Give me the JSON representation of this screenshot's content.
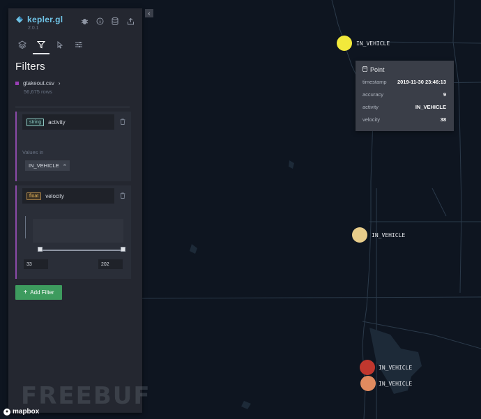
{
  "app": {
    "name": "kepler.gl",
    "version": "2.0.1"
  },
  "panel": {
    "title": "Filters",
    "dataset": {
      "name": "gtakeout.csv",
      "rows": "56,675 rows",
      "color": "#9a3fb5"
    },
    "filters": [
      {
        "type": "string",
        "field": "activity",
        "values_label": "Values in",
        "selected_value": "IN_VEHICLE"
      },
      {
        "type": "float",
        "field": "velocity",
        "range_min": "33",
        "range_max": "202"
      }
    ],
    "add_filter_label": "Add Filter"
  },
  "tooltip": {
    "title": "Point",
    "rows": [
      {
        "key": "timestamp",
        "value": "2019-11-30 23:46:13"
      },
      {
        "key": "accuracy",
        "value": "9"
      },
      {
        "key": "activity",
        "value": "IN_VEHICLE"
      },
      {
        "key": "velocity",
        "value": "38"
      }
    ]
  },
  "map_points": [
    {
      "label": "IN_VEHICLE",
      "color": "#f2e93b"
    },
    {
      "label": "IN_VEHICLE",
      "color": "#e8cd8b"
    },
    {
      "label": "IN_VEHICLE",
      "color": "#c0372e"
    },
    {
      "label": "IN_VEHICLE",
      "color": "#e18b5f"
    }
  ],
  "attribution": "mapbox",
  "watermark": "FREEBUF",
  "colors": {
    "accent_blue": "#6fc3e6",
    "add_filter_green": "#3d9b5e",
    "filter_purple": "#8b49a8"
  }
}
